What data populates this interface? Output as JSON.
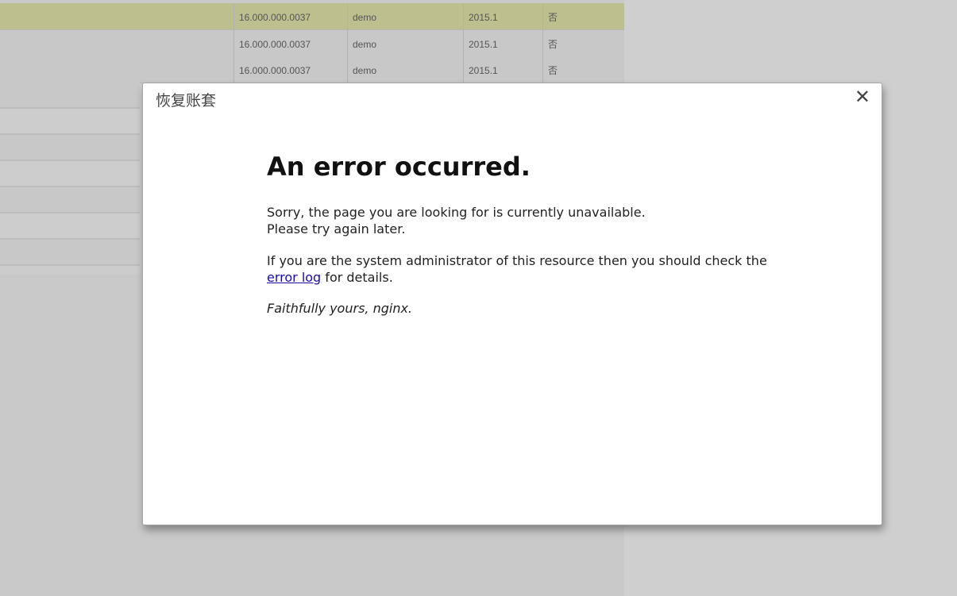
{
  "background_table": {
    "rows": [
      {
        "account": "16.000.000.0037",
        "user": "demo",
        "date": "2015.1",
        "flag": "否"
      },
      {
        "account": "16.000.000.0037",
        "user": "demo",
        "date": "2015.1",
        "flag": "否"
      },
      {
        "account": "16.000.000.0037",
        "user": "demo",
        "date": "2015.1",
        "flag": "否"
      }
    ]
  },
  "dialog": {
    "title": "恢复账套",
    "close_symbol": "✕",
    "heading": "An error occurred.",
    "paragraph1_line1": "Sorry, the page you are looking for is currently unavailable.",
    "paragraph1_line2": "Please try again later.",
    "paragraph2_before": "If you are the system administrator of this resource then you should check the",
    "paragraph2_link": "error log",
    "paragraph2_after": " for details.",
    "signature": "Faithfully yours, nginx."
  }
}
